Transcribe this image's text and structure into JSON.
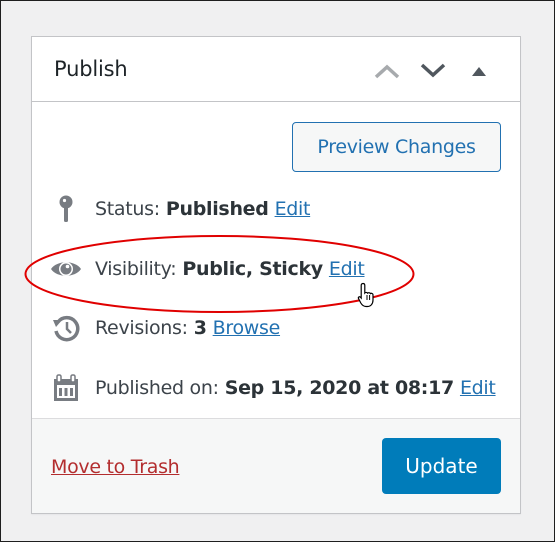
{
  "postbox": {
    "title": "Publish",
    "handle_actions": [
      {
        "name": "move-up",
        "icon": "chevron-up-icon"
      },
      {
        "name": "move-down",
        "icon": "chevron-down-icon"
      },
      {
        "name": "toggle-panel",
        "icon": "triangle-up-icon"
      }
    ]
  },
  "preview_button": {
    "label": "Preview Changes"
  },
  "misc": {
    "status": {
      "icon": "pin-icon",
      "label": "Status:",
      "value": "Published",
      "link": "Edit"
    },
    "visibility": {
      "icon": "eye-icon",
      "label": "Visibility:",
      "value": "Public, Sticky",
      "link": "Edit"
    },
    "revisions": {
      "icon": "history-icon",
      "label": "Revisions:",
      "value": "3",
      "link": "Browse"
    },
    "published_on": {
      "icon": "calendar-icon",
      "label": "Published on:",
      "value": "Sep 15, 2020 at 08:17",
      "link": "Edit"
    }
  },
  "major_actions": {
    "trash_label": "Move to Trash",
    "update_label": "Update"
  },
  "annotation": {
    "highlight_color": "#e00000",
    "highlighted_item": "visibility"
  },
  "colors": {
    "link": "#2271b1",
    "primary": "#007cba",
    "trash": "#b32d2e"
  }
}
